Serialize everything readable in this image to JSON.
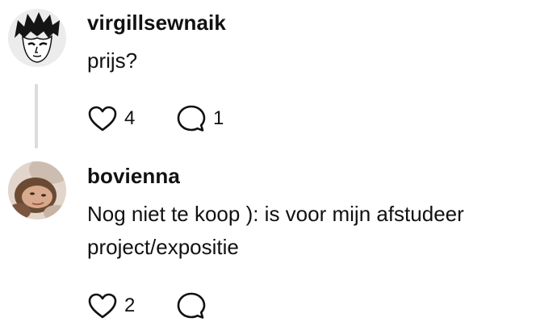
{
  "comments": [
    {
      "username": "virgillsewnaik",
      "text": "prijs?",
      "likes": "4",
      "replies": "1",
      "avatar_icon": "cartoon-face-avatar"
    },
    {
      "username": "bovienna",
      "text": "Nog niet te koop ): is voor mijn afstudeer project/expositie",
      "likes": "2",
      "replies": "",
      "avatar_icon": "photo-avatar"
    }
  ],
  "colors": {
    "text": "#111111",
    "thread_line": "#dcdcdc",
    "background": "#ffffff"
  }
}
